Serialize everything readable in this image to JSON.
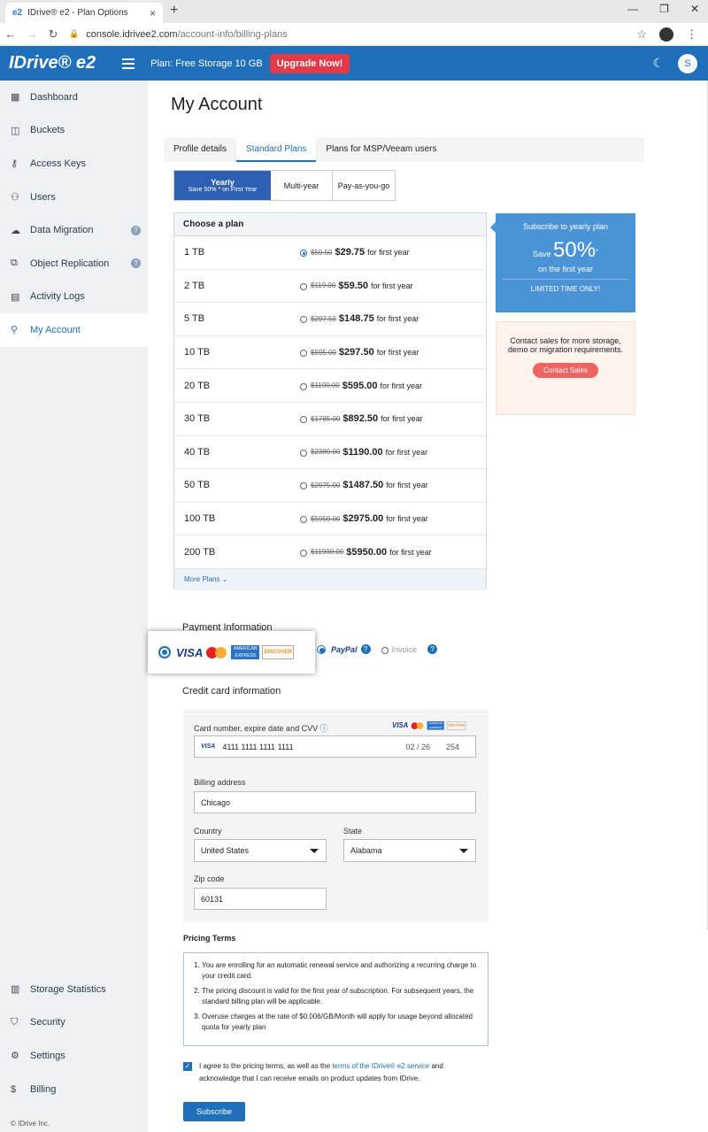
{
  "browser": {
    "tab_title": "IDrive® e2 - Plan Options",
    "tab_favicon": "e2",
    "url_host": "console.idrivee2.com",
    "url_path": "/account-info/billing-plans"
  },
  "header": {
    "logo": "IDrive® e2",
    "plan_text": "Plan: Free Storage 10 GB",
    "upgrade_label": "Upgrade Now!",
    "avatar_letter": "S"
  },
  "sidebar": {
    "items": [
      {
        "label": "Dashboard",
        "icon": "dashboard-icon"
      },
      {
        "label": "Buckets",
        "icon": "bucket-icon"
      },
      {
        "label": "Access Keys",
        "icon": "key-icon"
      },
      {
        "label": "Users",
        "icon": "users-icon"
      },
      {
        "label": "Data Migration",
        "icon": "cloud-migration-icon"
      },
      {
        "label": "Object Replication",
        "icon": "replication-icon"
      },
      {
        "label": "Activity Logs",
        "icon": "log-icon"
      },
      {
        "label": "My Account",
        "icon": "user-icon"
      }
    ],
    "bottom_items": [
      {
        "label": "Storage Statistics",
        "icon": "stats-icon"
      },
      {
        "label": "Security",
        "icon": "shield-icon"
      },
      {
        "label": "Settings",
        "icon": "gear-icon"
      },
      {
        "label": "Billing",
        "icon": "dollar-icon"
      }
    ],
    "copyright": "© IDrive Inc."
  },
  "main": {
    "title": "My Account",
    "tabs": [
      "Profile details",
      "Standard Plans",
      "Plans for MSP/Veeam users"
    ],
    "term": {
      "yearly": "Yearly",
      "yearly_sub": "Save 50%",
      "yearly_star": "*",
      "yearly_sub2": "on First Year",
      "multi": "Multi-year",
      "payg": "Pay-as-you-go"
    },
    "plans_header": "Choose a plan",
    "plans": [
      {
        "size": "1 TB",
        "old": "$59.50",
        "new": "$29.75",
        "suffix": "for first year"
      },
      {
        "size": "2 TB",
        "old": "$119.00",
        "new": "$59.50",
        "suffix": "for first year"
      },
      {
        "size": "5 TB",
        "old": "$297.50",
        "new": "$148.75",
        "suffix": "for first year"
      },
      {
        "size": "10 TB",
        "old": "$595.00",
        "new": "$297.50",
        "suffix": "for first year"
      },
      {
        "size": "20 TB",
        "old": "$1190.00",
        "new": "$595.00",
        "suffix": "for first year"
      },
      {
        "size": "30 TB",
        "old": "$1785.00",
        "new": "$892.50",
        "suffix": "for first year"
      },
      {
        "size": "40 TB",
        "old": "$2380.00",
        "new": "$1190.00",
        "suffix": "for first year"
      },
      {
        "size": "50 TB",
        "old": "$2975.00",
        "new": "$1487.50",
        "suffix": "for first year"
      },
      {
        "size": "100 TB",
        "old": "$5950.00",
        "new": "$2975.00",
        "suffix": "for first year"
      },
      {
        "size": "200 TB",
        "old": "$11900.00",
        "new": "$5950.00",
        "suffix": "for first year"
      }
    ],
    "more_plans": "More Plans",
    "promo": {
      "line1": "Subscribe to yearly plan",
      "save": "Save",
      "pct": "50%",
      "star": "*",
      "line3": "on the first year",
      "line4": "LIMITED TIME ONLY!"
    },
    "sales": {
      "text": "Contact sales for more storage, demo or migration requirements.",
      "button": "Contact Sales"
    },
    "payment": {
      "title": "Payment Information",
      "visa": "VISA",
      "amex": "AMERICAN EXPRESS",
      "discover": "DISCOVER",
      "paypal": "PayPal",
      "invoice": "Invoice"
    },
    "credit": {
      "title": "Credit card information",
      "card_label": "Card number, expire date and CVV",
      "card_number": "4111 1111 1111 1111",
      "card_brand": "VISA",
      "expiry": "02 / 26",
      "cvv": "254",
      "billing_label": "Billing address",
      "billing_value": "Chicago",
      "country_label": "Country",
      "country_value": "United States",
      "state_label": "State",
      "state_value": "Alabama",
      "zip_label": "Zip code",
      "zip_value": "60131"
    },
    "pricing": {
      "title": "Pricing Terms",
      "terms": [
        "You are enrolling for an automatic renewal service and authorizing a recurring charge to your credit card.",
        "The pricing discount is valid for the first year of subscription. For subsequent years, the standard billing plan will be applicable.",
        "Overuse charges at the rate of $0.006/GB/Month will apply for usage beyond allocated quota for yearly plan"
      ]
    },
    "agree": {
      "pre": "I agree to the pricing terms, as well as the",
      "link": "terms of the IDrive® e2 service",
      "post": "and acknowledge that I can receive emails on product updates from IDrive."
    },
    "subscribe": "Subscribe"
  }
}
